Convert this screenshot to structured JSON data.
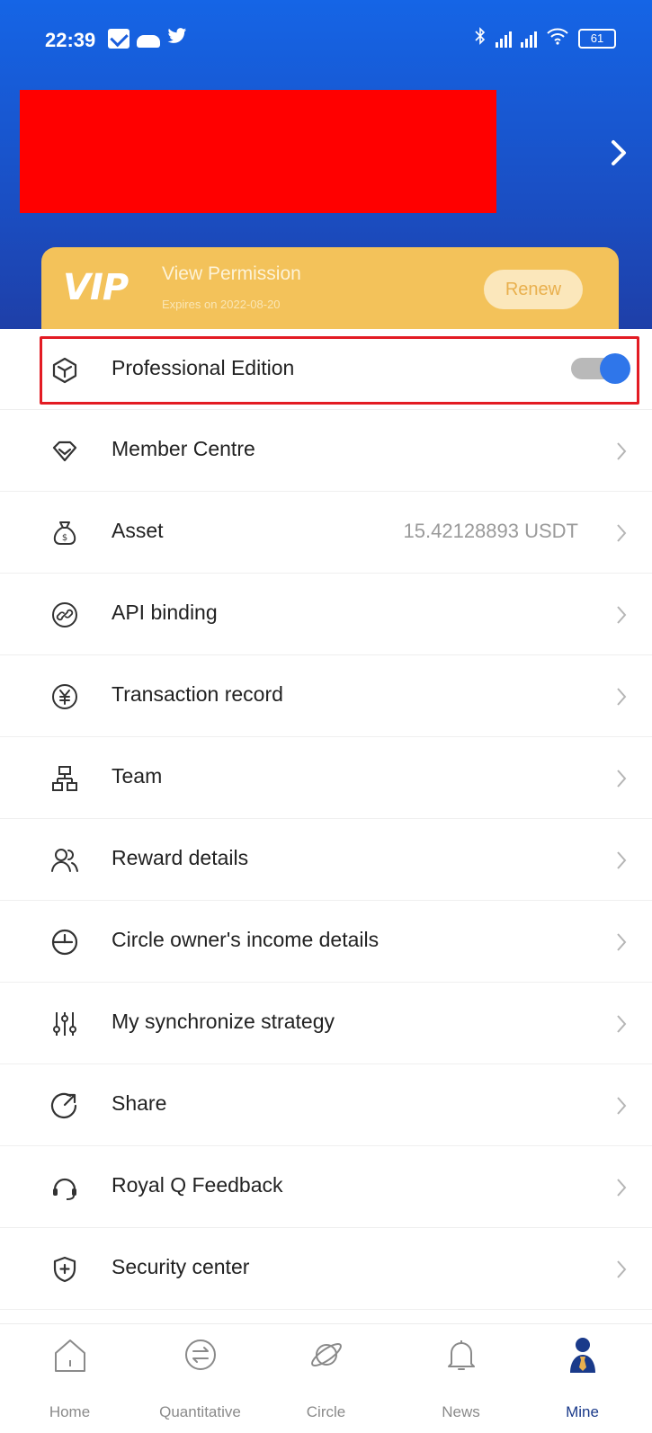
{
  "status_bar": {
    "time": "22:39",
    "battery": "61",
    "icons": [
      "mail-icon",
      "cloud-icon",
      "twitter-icon",
      "bluetooth-icon",
      "signal-icon",
      "signal-icon",
      "wifi-icon",
      "battery-icon"
    ]
  },
  "colors": {
    "header_blue": "#1a5ddc",
    "vip_gold": "#f3c25a",
    "toggle_blue": "#2f76ea",
    "highlight_red": "#e31b23",
    "redaction": "#ff0000",
    "active_tab": "#1a3a8a"
  },
  "vip": {
    "logo": "VIP",
    "title": "View Permission",
    "expiry": "Expires on 2022-08-20",
    "renew_label": "Renew"
  },
  "menu": {
    "professional": {
      "label": "Professional Edition",
      "icon": "cube-icon",
      "toggle_on": true
    },
    "items": [
      {
        "label": "Member Centre",
        "icon": "diamond-icon"
      },
      {
        "label": "Asset",
        "icon": "money-bag-icon",
        "value": "15.42128893 USDT"
      },
      {
        "label": "API binding",
        "icon": "link-icon"
      },
      {
        "label": "Transaction record",
        "icon": "yen-circle-icon"
      },
      {
        "label": "Team",
        "icon": "org-chart-icon"
      },
      {
        "label": "Reward details",
        "icon": "users-icon"
      },
      {
        "label": "Circle owner's income details",
        "icon": "clock-icon"
      },
      {
        "label": "My synchronize strategy",
        "icon": "sliders-icon"
      },
      {
        "label": "Share",
        "icon": "share-icon"
      },
      {
        "label": "Royal Q Feedback",
        "icon": "headset-icon"
      },
      {
        "label": "Security center",
        "icon": "shield-plus-icon"
      }
    ]
  },
  "tabs": [
    {
      "label": "Home",
      "icon": "home-icon",
      "active": false
    },
    {
      "label": "Quantitative",
      "icon": "exchange-icon",
      "active": false
    },
    {
      "label": "Circle",
      "icon": "planet-icon",
      "active": false
    },
    {
      "label": "News",
      "icon": "bell-icon",
      "active": false
    },
    {
      "label": "Mine",
      "icon": "person-icon",
      "active": true
    }
  ]
}
